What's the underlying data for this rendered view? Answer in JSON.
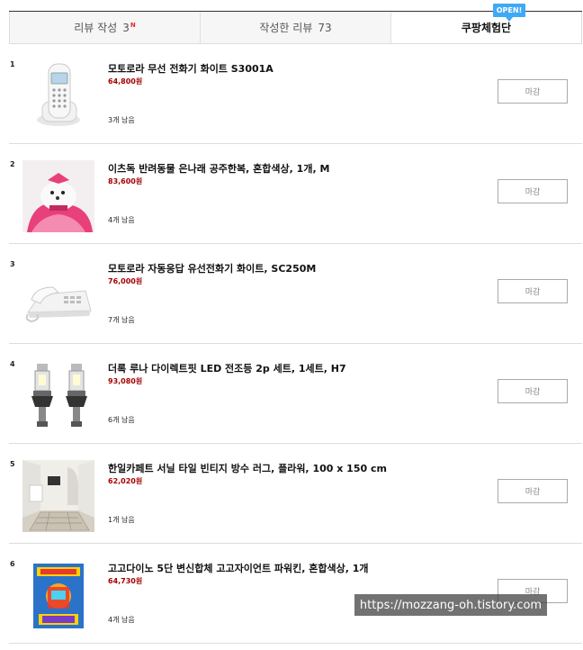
{
  "tabs": [
    {
      "label": "리뷰 작성",
      "count": "3",
      "badge": "N"
    },
    {
      "label": "작성한 리뷰",
      "count": "73"
    },
    {
      "label": "쿠팡체험단",
      "badge": "OPEN!"
    }
  ],
  "items": [
    {
      "rank": "1",
      "title": "모토로라 무선 전화기 화이트 S3001A",
      "price": "64,800원",
      "remaining": "3개 남음",
      "button": "마감",
      "image": "cordless-phone-image"
    },
    {
      "rank": "2",
      "title": "이츠독 반려동물 은나래 공주한복, 혼합색상, 1개, M",
      "price": "83,600원",
      "remaining": "4개 남음",
      "button": "마감",
      "image": "pet-hanbok-image"
    },
    {
      "rank": "3",
      "title": "모토로라 자동응답 유선전화기 화이트, SC250M",
      "price": "76,000원",
      "remaining": "7개 남음",
      "button": "마감",
      "image": "corded-phone-image"
    },
    {
      "rank": "4",
      "title": "더록 루나 다이렉트핏 LED 전조등 2p 세트, 1세트, H7",
      "price": "93,080원",
      "remaining": "6개 남음",
      "button": "마감",
      "image": "led-bulb-image"
    },
    {
      "rank": "5",
      "title": "한일카페트 서닐 타일 빈티지 방수 러그, 플라워, 100 x 150 cm",
      "price": "62,020원",
      "remaining": "1개 남음",
      "button": "마감",
      "image": "rug-room-image"
    },
    {
      "rank": "6",
      "title": "고고다이노 5단 변신합체 고고자이언트 파워킨, 혼합색상, 1개",
      "price": "64,730원",
      "remaining": "4개 남음",
      "button": "마감",
      "image": "toy-box-image"
    }
  ],
  "watermark": "https://mozzang-oh.tistory.com",
  "colors": {
    "price": "#a50000",
    "badge": "#3fa9f5",
    "new_mark": "#e8272a"
  }
}
